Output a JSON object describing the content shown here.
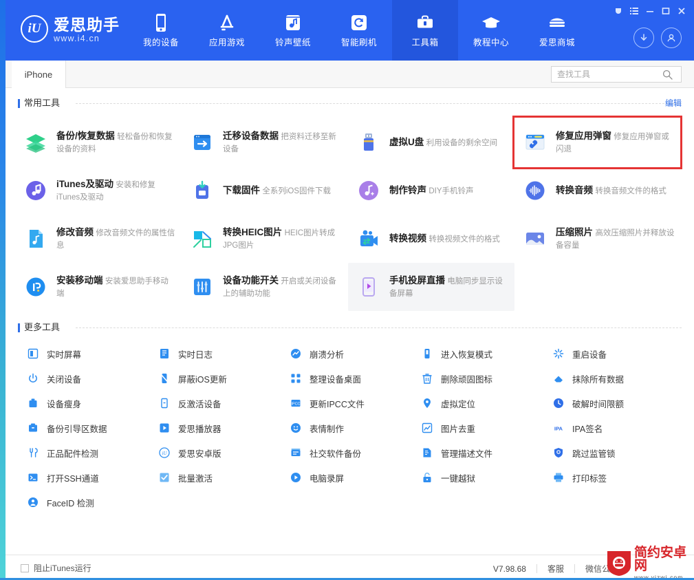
{
  "window": {
    "buttons": [
      {
        "name": "theme-icon",
        "glyph": "theme"
      },
      {
        "name": "menu-icon",
        "glyph": "menu"
      },
      {
        "name": "minimize-icon",
        "glyph": "minimize"
      },
      {
        "name": "maximize-icon",
        "glyph": "maximize"
      },
      {
        "name": "close-icon",
        "glyph": "close"
      }
    ]
  },
  "header": {
    "logo_mark": "iU",
    "logo_name": "爱思助手",
    "logo_url": "www.i4.cn",
    "accent": "#2a62f0",
    "active_accent": "#2356dd",
    "nav": [
      {
        "label": "我的设备",
        "icon": "phone-icon",
        "active": false
      },
      {
        "label": "应用游戏",
        "icon": "appstore-icon",
        "active": false
      },
      {
        "label": "铃声壁纸",
        "icon": "music-icon",
        "active": false
      },
      {
        "label": "智能刷机",
        "icon": "refresh-icon",
        "active": false
      },
      {
        "label": "工具箱",
        "icon": "toolbox-icon",
        "active": true
      },
      {
        "label": "教程中心",
        "icon": "graduation-icon",
        "active": false
      },
      {
        "label": "爱思商城",
        "icon": "store-icon",
        "active": false
      }
    ],
    "download_icon": "download-circle-icon",
    "account_icon": "account-circle-icon"
  },
  "tabbar": {
    "device_tab": "iPhone",
    "search": {
      "value": "",
      "placeholder": "查找工具"
    }
  },
  "sections": {
    "common": {
      "title": "常用工具",
      "edit_label": "编辑",
      "items": [
        {
          "name": "备份/恢复数据",
          "desc": "轻松备份和恢复设备的资料",
          "icon": "layers-icon",
          "state": "normal"
        },
        {
          "name": "迁移设备数据",
          "desc": "把资料迁移至新设备",
          "icon": "transfer-icon",
          "state": "normal"
        },
        {
          "name": "虚拟U盘",
          "desc": "利用设备的剩余空间",
          "icon": "usb-icon",
          "state": "normal"
        },
        {
          "name": "修复应用弹窗",
          "desc": "修复应用弹窗或闪退",
          "icon": "repair-window-icon",
          "state": "highlighted"
        },
        {
          "name": "iTunes及驱动",
          "desc": "安装和修复iTunes及驱动",
          "icon": "itunes-icon",
          "state": "normal"
        },
        {
          "name": "下载固件",
          "desc": "全系列iOS固件下载",
          "icon": "firmware-icon",
          "state": "normal"
        },
        {
          "name": "制作铃声",
          "desc": "DIY手机铃声",
          "icon": "ringtone-icon",
          "state": "normal"
        },
        {
          "name": "转换音频",
          "desc": "转换音频文件的格式",
          "icon": "waveform-icon",
          "state": "normal"
        },
        {
          "name": "修改音频",
          "desc": "修改音频文件的属性信息",
          "icon": "audio-file-icon",
          "state": "normal"
        },
        {
          "name": "转换HEIC图片",
          "desc": "HEIC图片转成JPG图片",
          "icon": "heic-icon",
          "state": "normal"
        },
        {
          "name": "转换视频",
          "desc": "转换视频文件的格式",
          "icon": "video-icon",
          "state": "normal"
        },
        {
          "name": "压缩照片",
          "desc": "高效压缩照片并释放设备容量",
          "icon": "photo-icon",
          "state": "normal"
        },
        {
          "name": "安装移动端",
          "desc": "安装爱思助手移动端",
          "icon": "mobile-install-icon",
          "state": "normal"
        },
        {
          "name": "设备功能开关",
          "desc": "开启或关闭设备上的辅助功能",
          "icon": "sliders-icon",
          "state": "normal"
        },
        {
          "name": "手机投屏直播",
          "desc": "电脑同步显示设备屏幕",
          "icon": "cast-icon",
          "state": "hover"
        }
      ]
    },
    "more": {
      "title": "更多工具",
      "items": [
        {
          "label": "实时屏幕",
          "icon": "screen-icon"
        },
        {
          "label": "实时日志",
          "icon": "log-icon"
        },
        {
          "label": "崩溃分析",
          "icon": "crash-icon"
        },
        {
          "label": "进入恢复模式",
          "icon": "recovery-icon"
        },
        {
          "label": "重启设备",
          "icon": "restart-icon"
        },
        {
          "label": "关闭设备",
          "icon": "power-icon"
        },
        {
          "label": "屏蔽iOS更新",
          "icon": "block-update-icon"
        },
        {
          "label": "整理设备桌面",
          "icon": "grid-icon"
        },
        {
          "label": "删除顽固图标",
          "icon": "trash-icon"
        },
        {
          "label": "抹除所有数据",
          "icon": "eraser-icon"
        },
        {
          "label": "设备瘦身",
          "icon": "slim-icon"
        },
        {
          "label": "反激活设备",
          "icon": "deactivate-icon"
        },
        {
          "label": "更新IPCC文件",
          "icon": "ipcc-icon"
        },
        {
          "label": "虚拟定位",
          "icon": "location-icon"
        },
        {
          "label": "破解时间限额",
          "icon": "clock-icon"
        },
        {
          "label": "备份引导区数据",
          "icon": "boot-backup-icon"
        },
        {
          "label": "爱思播放器",
          "icon": "player-icon"
        },
        {
          "label": "表情制作",
          "icon": "emoji-icon"
        },
        {
          "label": "图片去重",
          "icon": "dedup-icon"
        },
        {
          "label": "IPA签名",
          "icon": "ipa-icon"
        },
        {
          "label": "正品配件检测",
          "icon": "accessory-icon"
        },
        {
          "label": "爱思安卓版",
          "icon": "android-version-icon"
        },
        {
          "label": "社交软件备份",
          "icon": "social-backup-icon"
        },
        {
          "label": "管理描述文件",
          "icon": "profile-icon"
        },
        {
          "label": "跳过监管锁",
          "icon": "supervision-icon"
        },
        {
          "label": "打开SSH通道",
          "icon": "ssh-icon"
        },
        {
          "label": "批量激活",
          "icon": "batch-activate-icon"
        },
        {
          "label": "电脑录屏",
          "icon": "record-icon"
        },
        {
          "label": "一键越狱",
          "icon": "jailbreak-icon"
        },
        {
          "label": "打印标签",
          "icon": "printer-icon"
        },
        {
          "label": "FaceID 检测",
          "icon": "faceid-icon"
        }
      ]
    }
  },
  "footer": {
    "block_itunes_label": "阻止iTunes运行",
    "block_itunes_checked": false,
    "version": "V7.98.68",
    "links": [
      "客服",
      "微信公众"
    ],
    "watermark_cn": "简约安卓网",
    "watermark_url": "www.yjzwj.com"
  }
}
